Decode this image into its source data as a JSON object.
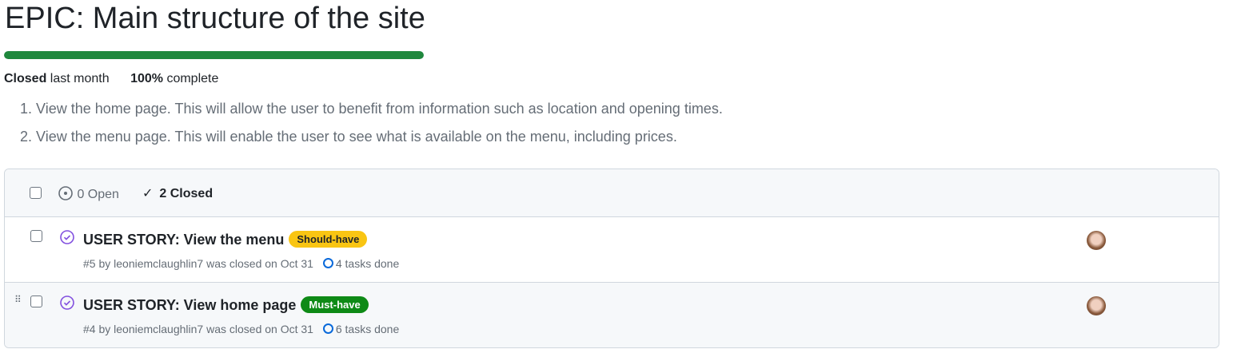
{
  "title": "EPIC: Main structure of the site",
  "progress": {
    "percent": 100,
    "color": "#1f883d"
  },
  "status": {
    "state": "Closed",
    "when": "last month",
    "percent": "100%",
    "complete": "complete"
  },
  "description": [
    "1. View the home page. This will allow the user to benefit from information such as location and opening times.",
    "2. View the menu page. This will enable the user to see what is available on the menu, including prices."
  ],
  "filter": {
    "open": "0 Open",
    "closed": "2 Closed"
  },
  "issues": [
    {
      "title": "USER STORY: View the menu",
      "label": "Should-have",
      "label_bg": "#f9c513",
      "label_fg": "#1f2328",
      "meta": "#5 by leoniemclaughlin7 was closed on Oct 31",
      "tasks": "4 tasks done"
    },
    {
      "title": "USER STORY: View home page",
      "label": "Must-have",
      "label_bg": "#0e8a16",
      "label_fg": "#ffffff",
      "meta": "#4 by leoniemclaughlin7 was closed on Oct 31",
      "tasks": "6 tasks done"
    }
  ]
}
